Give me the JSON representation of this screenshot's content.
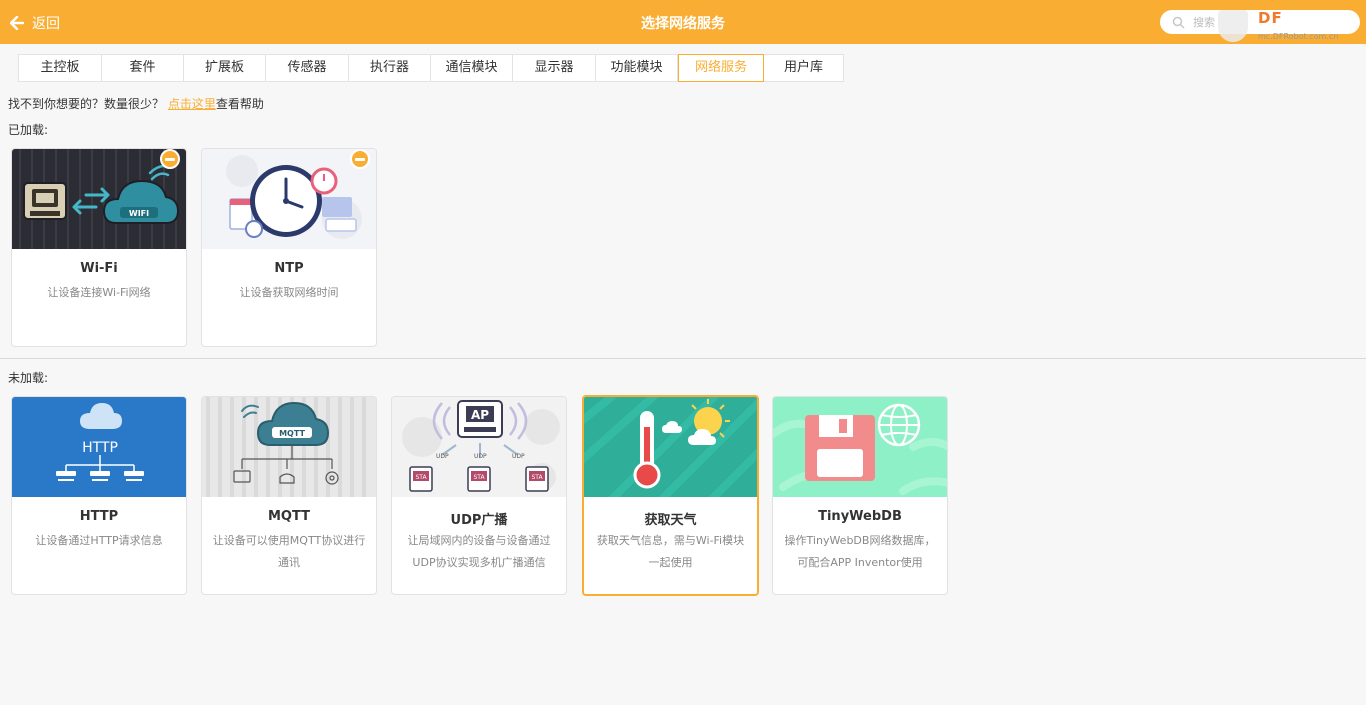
{
  "header": {
    "back_label": "返回",
    "title": "选择网络服务",
    "search_placeholder": "搜索",
    "watermark_logo": "DF",
    "watermark_url": "mc.DFRobot.com.cn",
    "accent": "#f9ae33"
  },
  "tabs": [
    {
      "label": "主控板"
    },
    {
      "label": "套件"
    },
    {
      "label": "扩展板"
    },
    {
      "label": "传感器"
    },
    {
      "label": "执行器"
    },
    {
      "label": "通信模块"
    },
    {
      "label": "显示器"
    },
    {
      "label": "功能模块"
    },
    {
      "label": "网络服务",
      "active": true
    },
    {
      "label": "用户库"
    }
  ],
  "help": {
    "prefix": "找不到你想要的？数量很少？",
    "link": "点击这里",
    "suffix": "查看帮助"
  },
  "loaded": {
    "label": "已加载:",
    "cards": [
      {
        "name": "Wi-Fi",
        "desc": "让设备连接Wi-Fi网络",
        "icon": "wifi-cloud-icon",
        "badge": "remove-icon",
        "image_text": "WIFI"
      },
      {
        "name": "NTP",
        "desc": "让设备获取网络时间",
        "icon": "clock-icon",
        "badge": "remove-icon"
      }
    ]
  },
  "unloaded": {
    "label": "未加载:",
    "cards": [
      {
        "name": "HTTP",
        "desc": "让设备通过HTTP请求信息",
        "icon": "http-network-icon",
        "image_text": "HTTP"
      },
      {
        "name": "MQTT",
        "desc": "让设备可以使用MQTT协议进行通讯",
        "icon": "mqtt-cloud-icon",
        "image_text": "MQTT"
      },
      {
        "name": "UDP广播",
        "desc": "让局域网内的设备与设备通过UDP协议实现多机广播通信",
        "icon": "udp-broadcast-icon",
        "image_text": "AP",
        "image_labels": [
          "UDP",
          "UDP",
          "UDP",
          "STA",
          "STA",
          "STA"
        ]
      },
      {
        "name": "获取天气",
        "desc": "获取天气信息，需与Wi-Fi模块一起使用",
        "icon": "weather-thermometer-icon",
        "selected": true
      },
      {
        "name": "TinyWebDB",
        "desc": "操作TinyWebDB网络数据库，可配合APP Inventor使用",
        "icon": "database-globe-icon"
      }
    ]
  }
}
